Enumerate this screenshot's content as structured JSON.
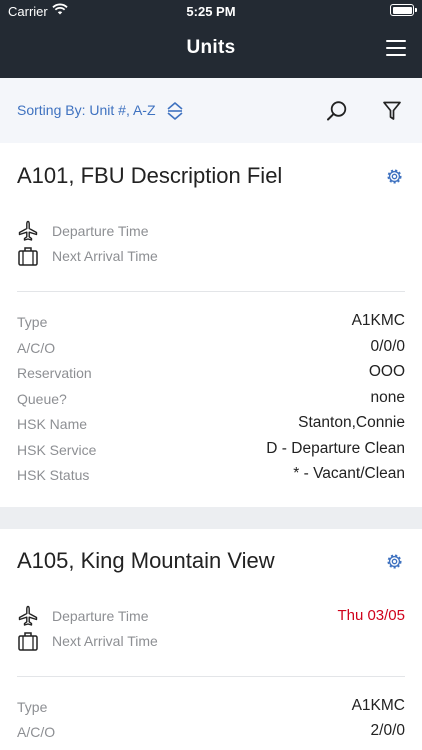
{
  "status_bar": {
    "carrier": "Carrier",
    "time": "5:25 PM"
  },
  "header": {
    "title": "Units"
  },
  "sort": {
    "label": "Sorting By: Unit #, A-Z"
  },
  "colors": {
    "header_bg": "#232a33",
    "accent": "#3f72c0",
    "alert": "#d0021b"
  },
  "icons": {
    "wifi": "wifi-icon",
    "battery": "battery-icon",
    "menu": "hamburger-menu-icon",
    "sort": "sort-up-down-icon",
    "search": "search-icon",
    "filter": "filter-icon",
    "settings": "gear-icon",
    "departure": "airplane-icon",
    "arrival": "luggage-icon"
  },
  "units": [
    {
      "title": "A101, FBU Description Fiel",
      "departure_label": "Departure Time",
      "departure_value": "",
      "arrival_label": "Next Arrival Time",
      "arrival_value": "",
      "fields": [
        {
          "label": "Type",
          "value": "A1KMC"
        },
        {
          "label": "A/C/O",
          "value": "0/0/0"
        },
        {
          "label": "Reservation",
          "value": "OOO"
        },
        {
          "label": "Queue?",
          "value": "none"
        },
        {
          "label": "HSK Name",
          "value": "Stanton,Connie"
        },
        {
          "label": "HSK Service",
          "value": "D - Departure Clean"
        },
        {
          "label": "HSK Status",
          "value": "* - Vacant/Clean"
        }
      ]
    },
    {
      "title": "A105, King Mountain View",
      "departure_label": "Departure Time",
      "departure_value": "Thu 03/05",
      "arrival_label": "Next Arrival Time",
      "arrival_value": "",
      "fields": [
        {
          "label": "Type",
          "value": "A1KMC"
        },
        {
          "label": "A/C/O",
          "value": "2/0/0"
        }
      ]
    }
  ]
}
